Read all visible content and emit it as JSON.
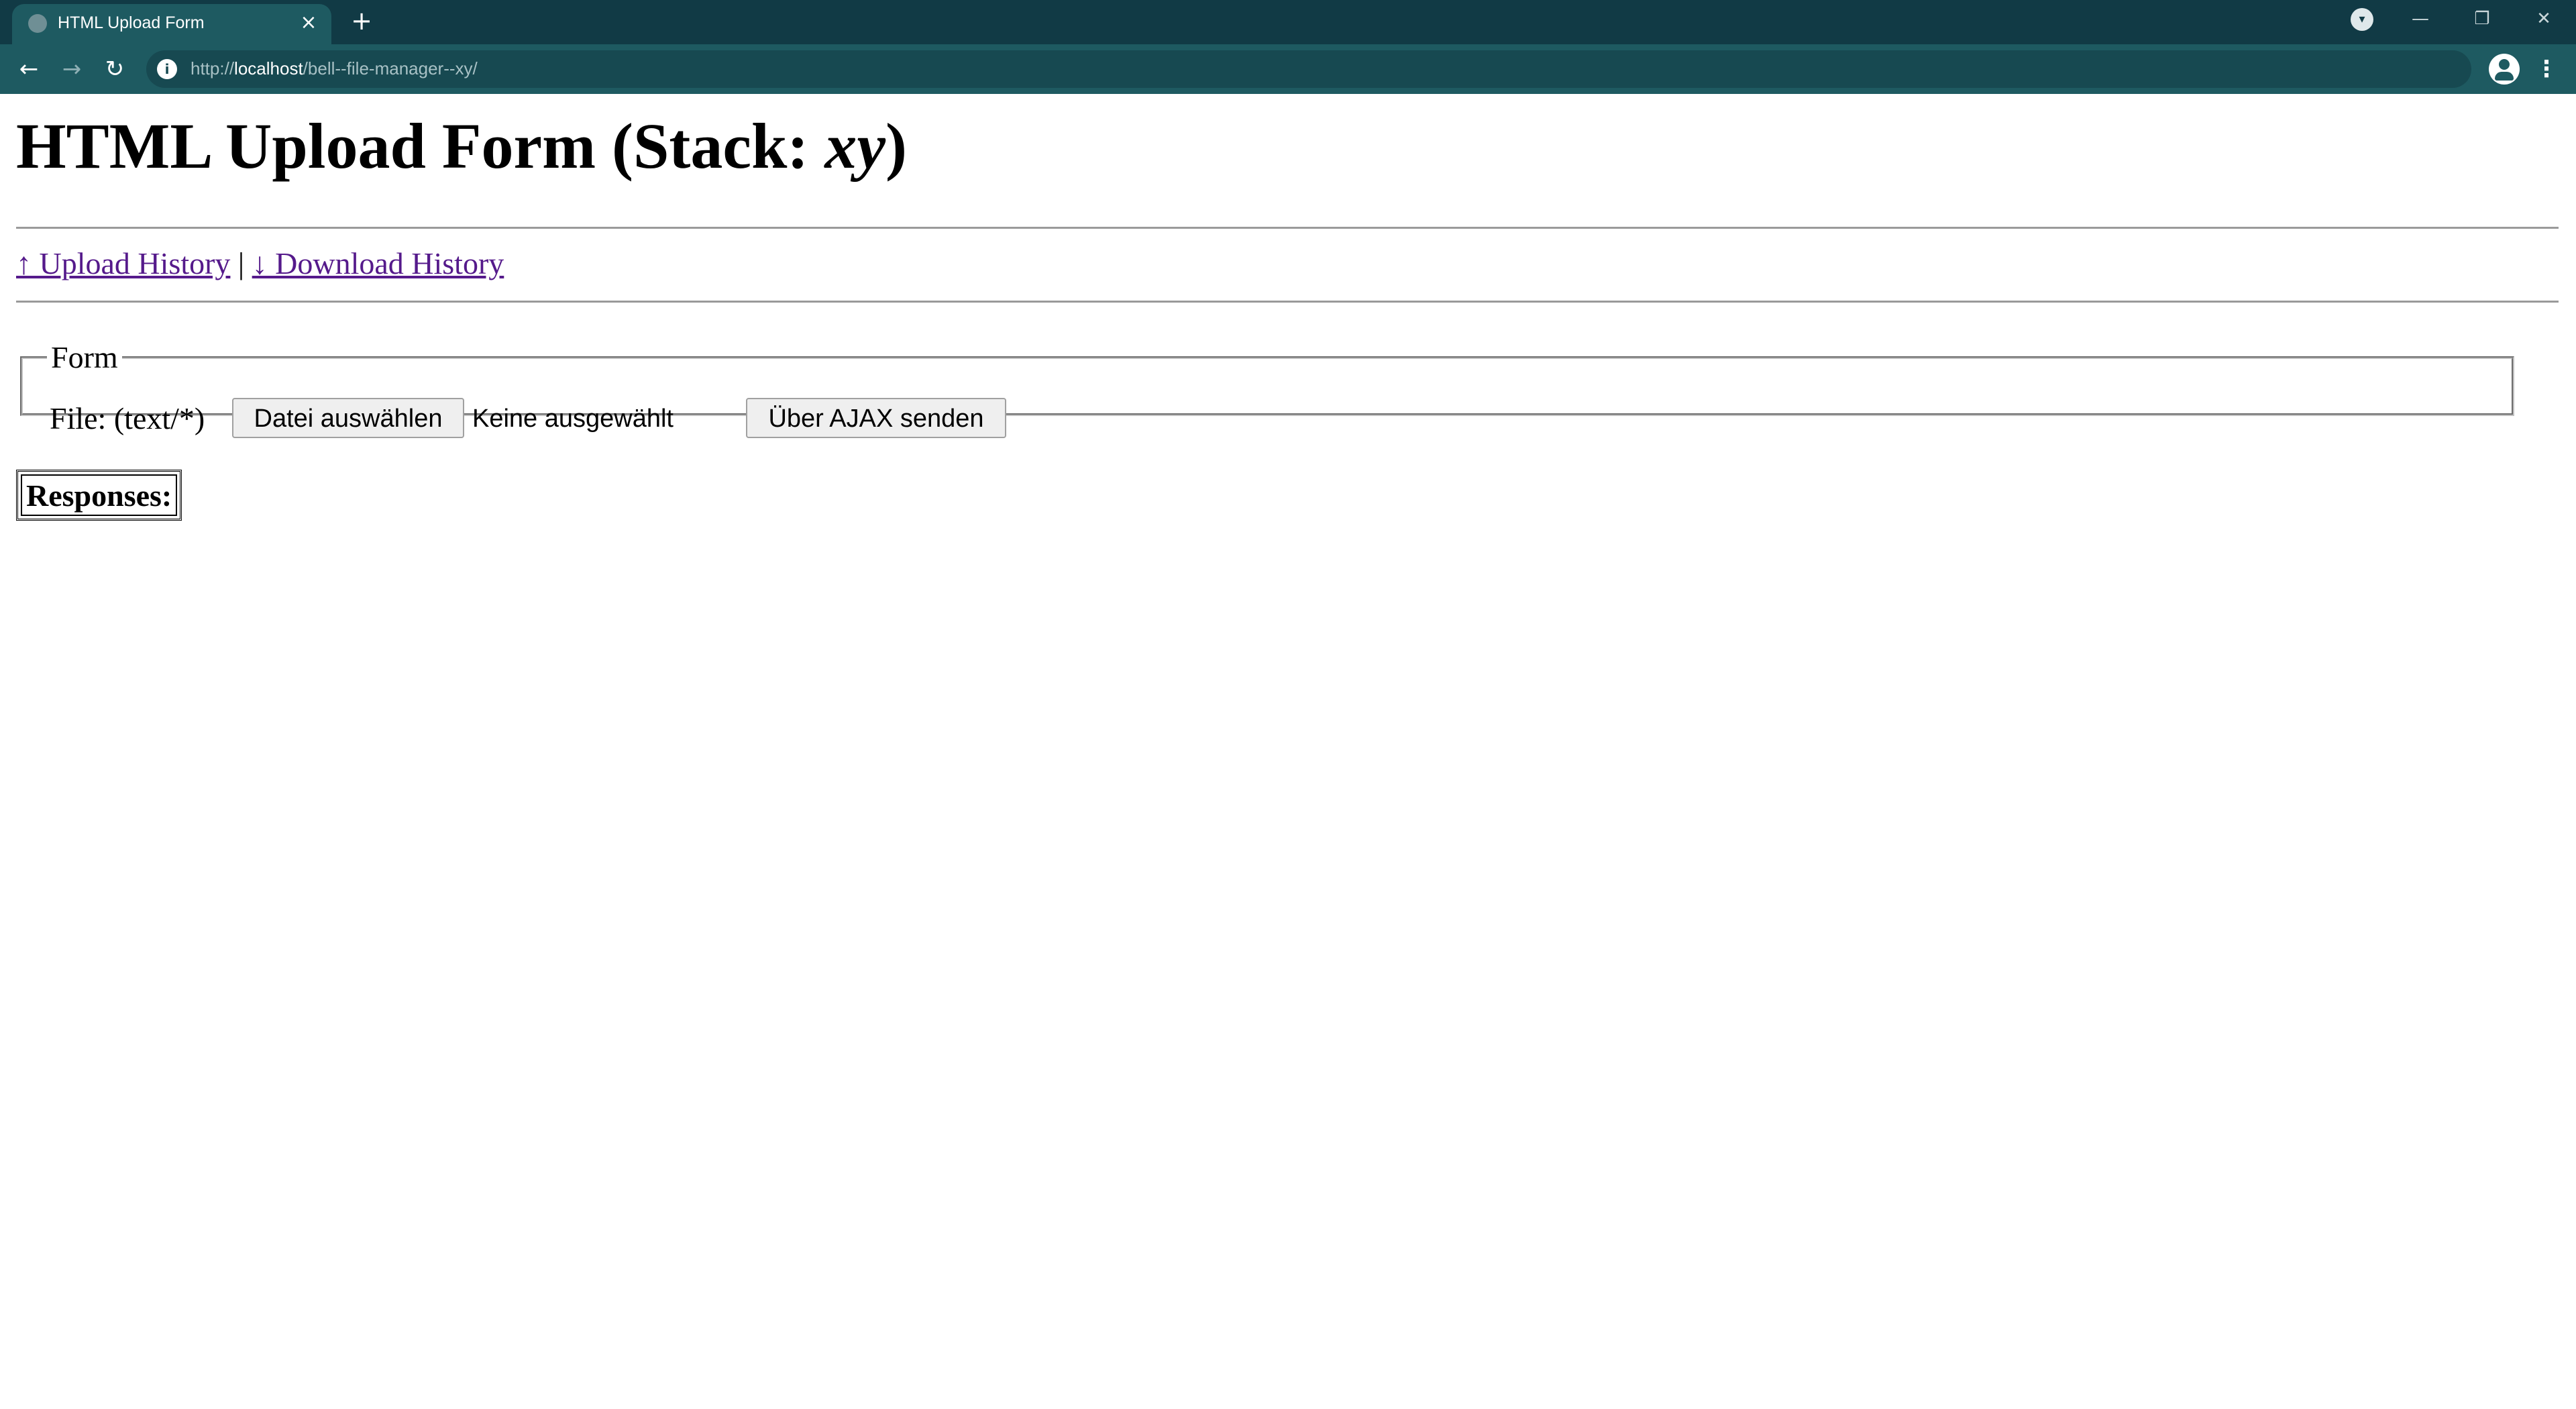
{
  "browser": {
    "tab_title": "HTML Upload Form",
    "tab_close": "×",
    "new_tab": "+",
    "url_prefix": "http://",
    "url_host": "localhost",
    "url_path": "/bell--file-manager--xy/",
    "back": "←",
    "forward": "→",
    "reload": "↻",
    "menu": "⋮",
    "window_controls": {
      "minimize": "—",
      "restore": "❐",
      "close": "✕"
    }
  },
  "page": {
    "title_main": "HTML Upload Form (Stack: ",
    "title_stack": "xy",
    "title_end": ")",
    "links": {
      "upload_history": "↑ Upload History",
      "separator": "|",
      "download_history": "↓ Download History"
    },
    "form": {
      "legend": "Form",
      "file_label": "File: (text/*)",
      "choose_file_button": "Datei auswählen",
      "no_file_text": "Keine ausgewählt",
      "send_button": "Über AJAX senden"
    },
    "responses_label": "Responses:"
  }
}
